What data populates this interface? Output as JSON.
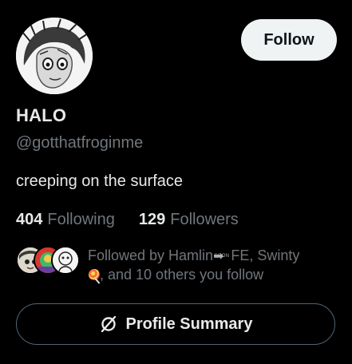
{
  "profile": {
    "display_name": "HALO",
    "handle": "@gotthatfroginme",
    "bio": "creeping on the surface",
    "following_count": "404",
    "following_label": "Following",
    "followers_count": "129",
    "followers_label": "Followers"
  },
  "actions": {
    "follow_label": "Follow",
    "summary_label": "Profile Summary",
    "summary_icon": "grok-icon"
  },
  "followed_by": {
    "prefix": "Followed by Hamlin",
    "move_emoji": "➡",
    "soon_text": "SOON",
    "first_suffix": "FE, Swinty",
    "lolly_emoji": "lollipop-icon",
    "rest": ", and 10 others you follow"
  },
  "colors": {
    "background": "#000000",
    "text_primary": "#e7e9ea",
    "text_secondary": "#71767b",
    "follow_button_bg": "#eff3f4",
    "outline": "#536471"
  }
}
